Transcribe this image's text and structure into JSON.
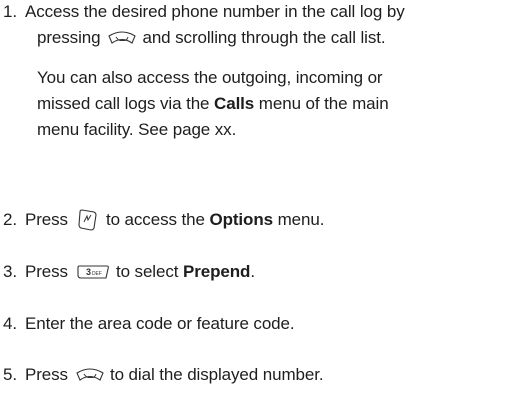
{
  "steps": [
    {
      "num": "1.",
      "line1": "Access the desired phone number in the call log by",
      "line2_pre": "pressing",
      "line2_post": "and scrolling through the call list.",
      "key_icon": "send-key-icon"
    },
    {
      "note_l1": "You can also access the outgoing, incoming or",
      "note_l2_pre": "missed call logs via the",
      "note_l2_bold": "Calls",
      "note_l2_post": "menu of the main",
      "note_l3": "menu facility. See page xx."
    },
    {
      "num": "2.",
      "pre": "Press",
      "post_pre": "to access the",
      "bold": "Options",
      "post": "menu.",
      "key_icon": "menu-key-icon"
    },
    {
      "num": "3.",
      "pre": "Press",
      "post_pre": "to select",
      "bold": "Prepend",
      "post": ".",
      "key_icon": "3-def-key-icon",
      "key_label": "3",
      "key_sub": "DEF"
    },
    {
      "num": "4.",
      "text": "Enter the area code or feature code."
    },
    {
      "num": "5.",
      "pre": "Press",
      "post": "to dial the displayed number.",
      "key_icon": "send-key-icon"
    }
  ]
}
